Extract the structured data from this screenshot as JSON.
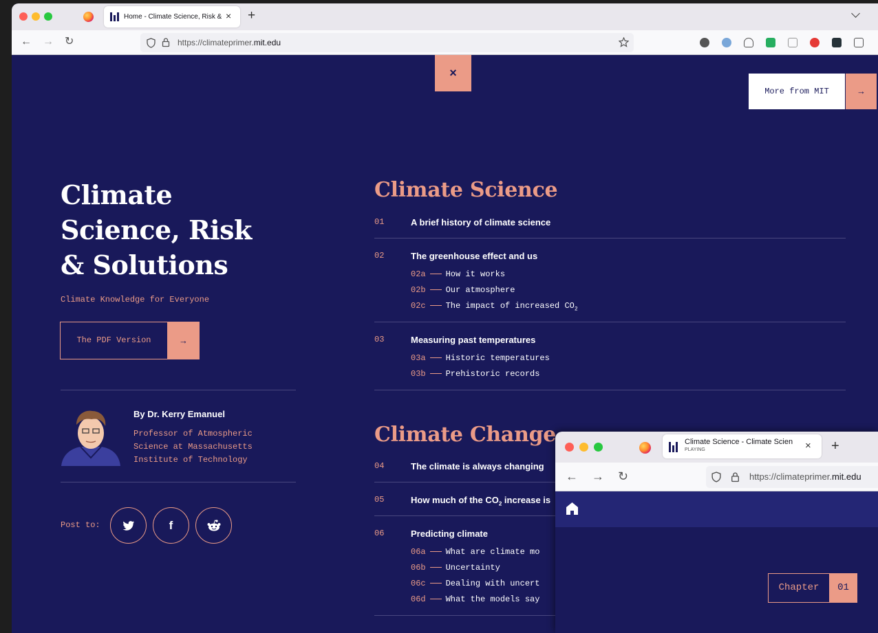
{
  "browser": {
    "tab_title": "Home - Climate Science, Risk & Solutions",
    "url_prefix": "https://climateprimer.",
    "url_domain": "mit.edu"
  },
  "page": {
    "close_icon": "×",
    "more_from_mit": "More from MIT",
    "arrow": "→",
    "hero_line1": "Climate",
    "hero_line2": "Science, Risk",
    "hero_line3": "& Solutions",
    "subtitle": "Climate Knowledge for Everyone",
    "pdf_button": "The PDF Version",
    "author_name": "By Dr. Kerry Emanuel",
    "author_role_line1": "Professor of Atmospheric",
    "author_role_line2": "Science at Massachusetts",
    "author_role_line3": "Institute of Technology",
    "post_to": "Post to:"
  },
  "toc": {
    "section1_title": "Climate Science",
    "section2_title": "Climate Change",
    "chapters": [
      {
        "num": "01",
        "title": "A brief history of climate science"
      },
      {
        "num": "02",
        "title": "The greenhouse effect and us"
      },
      {
        "num": "03",
        "title": "Measuring past temperatures"
      },
      {
        "num": "04",
        "title": "The climate is always changing"
      },
      {
        "num": "05",
        "title_a": "How much of the CO",
        "title_sub": "2",
        "title_b": " increase is"
      },
      {
        "num": "06",
        "title": "Predicting climate"
      }
    ],
    "subs": {
      "02a": {
        "code": "02a",
        "text": "How it works"
      },
      "02b": {
        "code": "02b",
        "text": "Our atmosphere"
      },
      "02c": {
        "code": "02c",
        "text": "The impact of increased CO",
        "sub": "2"
      },
      "03a": {
        "code": "03a",
        "text": "Historic temperatures"
      },
      "03b": {
        "code": "03b",
        "text": "Prehistoric records"
      },
      "06a": {
        "code": "06a",
        "text": "What are climate mo"
      },
      "06b": {
        "code": "06b",
        "text": "Uncertainty"
      },
      "06c": {
        "code": "06c",
        "text": "Dealing with uncert"
      },
      "06d": {
        "code": "06d",
        "text": "What the models say"
      }
    }
  },
  "popup": {
    "tab_title": "Climate Science - Climate Scien",
    "tab_status": "PLAYING",
    "url_prefix": "https://climateprimer.",
    "url_domain": "mit.edu",
    "chapter_label": "Chapter",
    "chapter_num": "01"
  },
  "colors": {
    "navy": "#19195a",
    "salmon": "#eb9b87",
    "white": "#ffffff"
  }
}
